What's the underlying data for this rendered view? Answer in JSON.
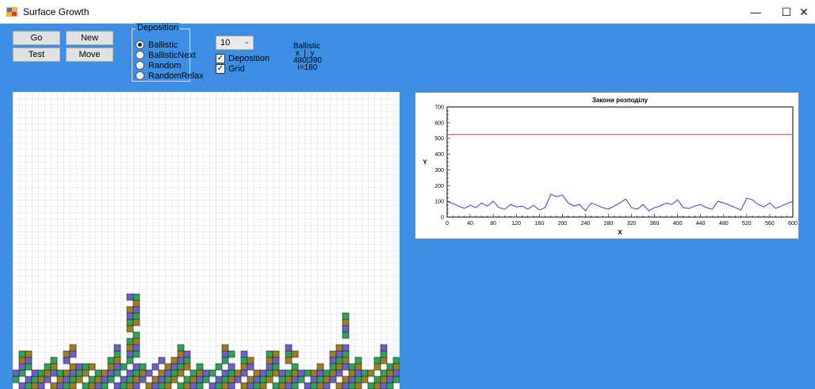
{
  "window": {
    "title": "Surface Growth",
    "min_glyph": "—",
    "max_glyph": "☐",
    "close_glyph": "✕"
  },
  "buttons": {
    "go": "Go",
    "new": "New",
    "test": "Test",
    "move": "Move"
  },
  "deposition_group": {
    "legend": "Deposition",
    "options": [
      "Ballistic",
      "BallisticNext",
      "Random",
      "RandomRelax"
    ],
    "selected": "Ballistic"
  },
  "combo": {
    "value": "10",
    "arrow": "⌄"
  },
  "checks": {
    "deposition": {
      "label": "Deposition",
      "checked": true
    },
    "grid": {
      "label": "Grid",
      "checked": true
    }
  },
  "info": {
    "line1": "Ballistic",
    "line2": " x  |  y",
    "line3": "480|390",
    "line4": "  i=180"
  },
  "colors": {
    "olive": "#a07f1e",
    "violet": "#6e5fd0",
    "green": "#2aa65a",
    "line_red": "#e03a3a",
    "line_blue": "#2b3fd8"
  },
  "chart_data": {
    "type": "line",
    "title": "Закони розподілу",
    "xlabel": "X",
    "ylabel": "Y",
    "xlim": [
      0,
      600
    ],
    "ylim": [
      0,
      700
    ],
    "xticks": [
      0,
      40,
      80,
      120,
      160,
      200,
      240,
      280,
      320,
      360,
      400,
      440,
      480,
      520,
      560,
      600
    ],
    "yticks": [
      0,
      100,
      200,
      300,
      400,
      500,
      600,
      700
    ],
    "series": [
      {
        "name": "",
        "color": "#e03a3a",
        "x": [
          0,
          600
        ],
        "y": [
          525,
          525
        ]
      },
      {
        "name": "",
        "color": "#2b3fd8",
        "x": [
          0,
          10,
          20,
          30,
          40,
          50,
          60,
          70,
          80,
          90,
          100,
          110,
          120,
          130,
          140,
          150,
          160,
          170,
          180,
          190,
          200,
          210,
          220,
          230,
          240,
          250,
          260,
          270,
          280,
          290,
          300,
          310,
          320,
          330,
          340,
          350,
          360,
          370,
          380,
          390,
          400,
          410,
          420,
          430,
          440,
          450,
          460,
          470,
          480,
          490,
          500,
          510,
          520,
          530,
          540,
          550,
          560,
          570,
          580,
          590,
          600
        ],
        "y": [
          100,
          85,
          70,
          55,
          75,
          60,
          90,
          70,
          100,
          60,
          50,
          80,
          65,
          70,
          50,
          75,
          45,
          60,
          145,
          130,
          140,
          90,
          70,
          80,
          40,
          90,
          75,
          60,
          50,
          70,
          90,
          115,
          60,
          50,
          80,
          40,
          60,
          70,
          90,
          80,
          110,
          60,
          55,
          70,
          80,
          60,
          50,
          100,
          90,
          75,
          60,
          45,
          120,
          110,
          80,
          65,
          90,
          55,
          70,
          85,
          100
        ]
      }
    ]
  }
}
